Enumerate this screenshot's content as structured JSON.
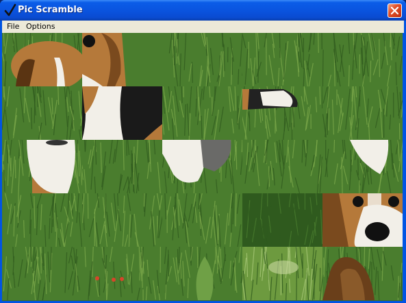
{
  "window": {
    "title": "Pic Scramble",
    "title_icon": "checkmark-icon",
    "close_icon": "close-icon"
  },
  "menu": {
    "items": [
      {
        "label": "File"
      },
      {
        "label": "Options"
      }
    ]
  },
  "puzzle": {
    "columns": 5,
    "rows": 5,
    "tiles": [
      {
        "row": 0,
        "col": 0,
        "content": "dog-ear-tan"
      },
      {
        "row": 0,
        "col": 1,
        "content": "dog-face-eye"
      },
      {
        "row": 0,
        "col": 2,
        "content": "grass"
      },
      {
        "row": 0,
        "col": 3,
        "content": "grass"
      },
      {
        "row": 0,
        "col": 4,
        "content": "grass"
      },
      {
        "row": 1,
        "col": 0,
        "content": "grass"
      },
      {
        "row": 1,
        "col": 1,
        "content": "dog-body-black-white"
      },
      {
        "row": 1,
        "col": 2,
        "content": "grass"
      },
      {
        "row": 1,
        "col": 3,
        "content": "dog-tail"
      },
      {
        "row": 1,
        "col": 4,
        "content": "grass"
      },
      {
        "row": 2,
        "col": 0,
        "content": "dog-chest"
      },
      {
        "row": 2,
        "col": 1,
        "content": "grass"
      },
      {
        "row": 2,
        "col": 2,
        "content": "dog-paw"
      },
      {
        "row": 2,
        "col": 3,
        "content": "grass"
      },
      {
        "row": 2,
        "col": 4,
        "content": "dog-leg"
      },
      {
        "row": 3,
        "col": 0,
        "content": "grass"
      },
      {
        "row": 3,
        "col": 1,
        "content": "grass"
      },
      {
        "row": 3,
        "col": 2,
        "content": "grass"
      },
      {
        "row": 3,
        "col": 3,
        "content": "grass-dark"
      },
      {
        "row": 3,
        "col": 4,
        "content": "dog-face-nose"
      },
      {
        "row": 4,
        "col": 0,
        "content": "grass"
      },
      {
        "row": 4,
        "col": 1,
        "content": "grass-red-flowers"
      },
      {
        "row": 4,
        "col": 2,
        "content": "grass-leaf"
      },
      {
        "row": 4,
        "col": 3,
        "content": "grass-light"
      },
      {
        "row": 4,
        "col": 4,
        "content": "dog-ear-brown"
      }
    ]
  },
  "colors": {
    "titlebar": "#0a54df",
    "menubar": "#ece9d8",
    "grass_dark": "#2f5a1e",
    "grass_mid": "#4a7d2e",
    "grass_light": "#7aa84a",
    "dog_tan": "#b5793a",
    "dog_black": "#1a1a1a",
    "dog_white": "#f2efe8"
  }
}
